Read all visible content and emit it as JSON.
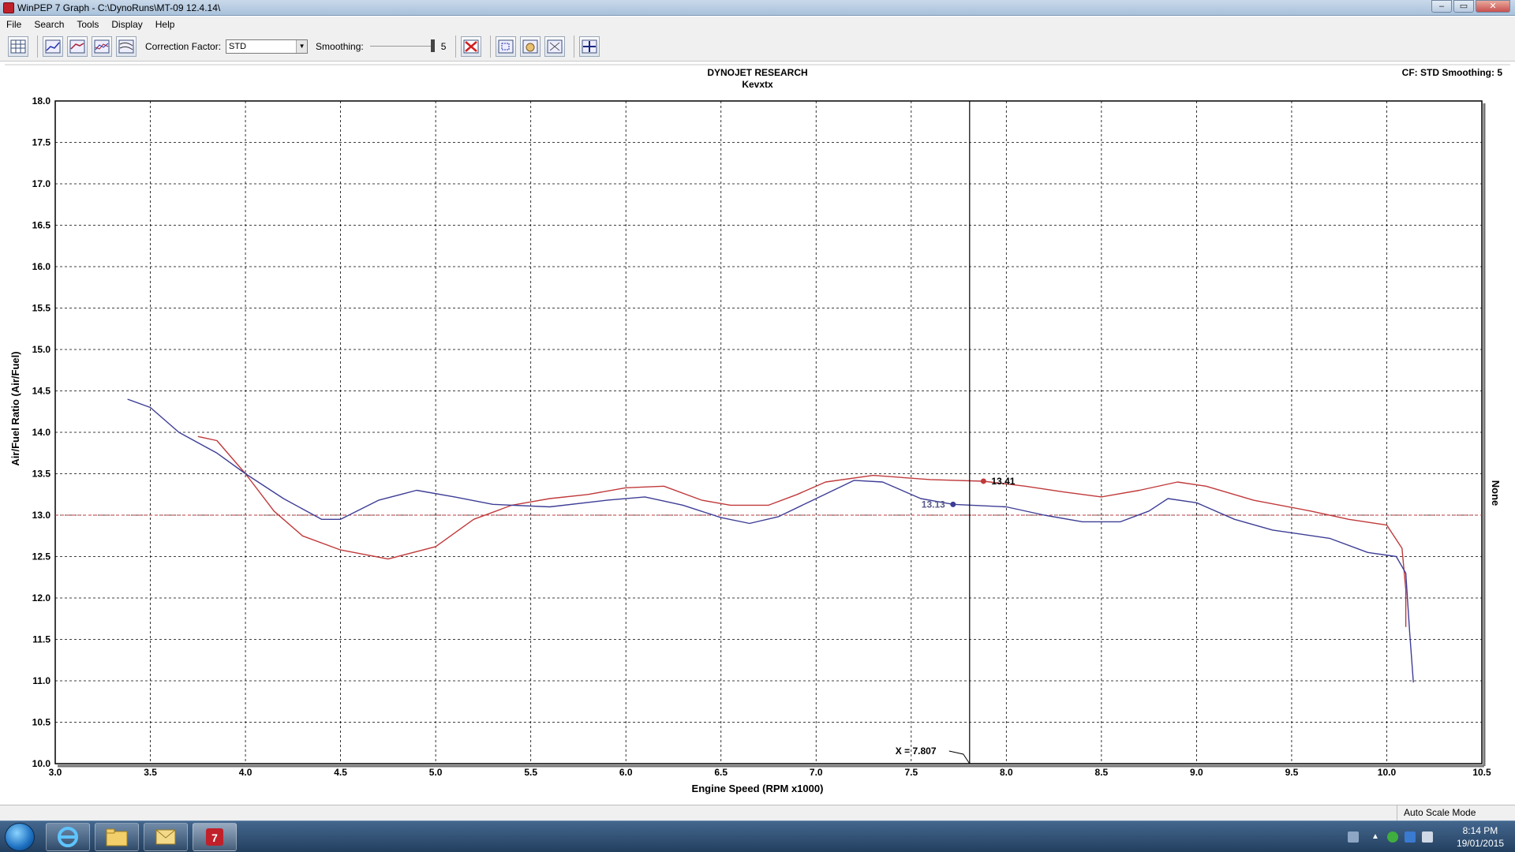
{
  "window": {
    "title": "WinPEP 7   Graph - C:\\DynoRuns\\MT-09 12.4.14\\",
    "controls": [
      "–",
      "▭",
      "✕"
    ]
  },
  "menu": [
    "File",
    "Search",
    "Tools",
    "Display",
    "Help"
  ],
  "toolbar": {
    "correction_label": "Correction Factor:",
    "correction_value": "STD",
    "smoothing_label": "Smoothing:",
    "smoothing_value": "5",
    "icons": [
      "grid-icon",
      "graph-hp-icon",
      "graph-torque-icon",
      "graph-multi-icon",
      "graph-overlay-icon",
      "remove-run-icon",
      "zoom-icon",
      "pan-hand-icon",
      "autoscale-icon",
      "crosshair-icon"
    ]
  },
  "colors": {
    "red_series": "#c0393b",
    "blue_series": "#3d3d96",
    "grid": "#000000",
    "cursor_line": "#000000"
  },
  "chart_data": {
    "type": "line",
    "title": "DYNOJET RESEARCH",
    "subtitle": "Kevxtx",
    "top_right": "CF: STD  Smoothing: 5",
    "right_axis_label": "None",
    "xlabel": "Engine Speed (RPM x1000)",
    "ylabel": "Air/Fuel Ratio (Air/Fuel)",
    "xlim": [
      3.0,
      10.5
    ],
    "ylim": [
      10.0,
      18.0
    ],
    "xticks": [
      "3.0",
      "3.5",
      "4.0",
      "4.5",
      "5.0",
      "5.5",
      "6.0",
      "6.5",
      "7.0",
      "7.5",
      "8.0",
      "8.5",
      "9.0",
      "9.5",
      "10.0",
      "10.5"
    ],
    "yticks": [
      "10.0",
      "10.5",
      "11.0",
      "11.5",
      "12.0",
      "12.5",
      "13.0",
      "13.5",
      "14.0",
      "14.5",
      "15.0",
      "15.5",
      "16.0",
      "16.5",
      "17.0",
      "17.5",
      "18.0"
    ],
    "grid": true,
    "reference_line_y": 13.0,
    "cursor": {
      "x": 7.807,
      "label": "X = 7.807"
    },
    "series": [
      {
        "color": "#c0393b",
        "marker": {
          "x": 7.88,
          "y": 13.41,
          "label": "13.41"
        },
        "points": [
          [
            3.75,
            13.95
          ],
          [
            3.85,
            13.9
          ],
          [
            4.0,
            13.5
          ],
          [
            4.15,
            13.05
          ],
          [
            4.3,
            12.75
          ],
          [
            4.5,
            12.58
          ],
          [
            4.75,
            12.47
          ],
          [
            5.0,
            12.62
          ],
          [
            5.2,
            12.95
          ],
          [
            5.4,
            13.12
          ],
          [
            5.6,
            13.2
          ],
          [
            5.8,
            13.25
          ],
          [
            6.0,
            13.33
          ],
          [
            6.2,
            13.35
          ],
          [
            6.4,
            13.18
          ],
          [
            6.55,
            13.12
          ],
          [
            6.75,
            13.12
          ],
          [
            6.9,
            13.25
          ],
          [
            7.05,
            13.4
          ],
          [
            7.3,
            13.48
          ],
          [
            7.6,
            13.43
          ],
          [
            7.88,
            13.41
          ],
          [
            8.1,
            13.35
          ],
          [
            8.3,
            13.28
          ],
          [
            8.5,
            13.22
          ],
          [
            8.7,
            13.3
          ],
          [
            8.9,
            13.4
          ],
          [
            9.05,
            13.35
          ],
          [
            9.3,
            13.18
          ],
          [
            9.6,
            13.05
          ],
          [
            9.8,
            12.95
          ],
          [
            10.0,
            12.88
          ],
          [
            10.08,
            12.6
          ],
          [
            10.1,
            12.1
          ],
          [
            10.1,
            11.65
          ]
        ]
      },
      {
        "color": "#3d3d96",
        "marker": {
          "x": 7.72,
          "y": 13.13,
          "label": "13.13"
        },
        "points": [
          [
            3.38,
            14.4
          ],
          [
            3.5,
            14.3
          ],
          [
            3.65,
            14.0
          ],
          [
            3.85,
            13.75
          ],
          [
            4.0,
            13.5
          ],
          [
            4.2,
            13.2
          ],
          [
            4.4,
            12.95
          ],
          [
            4.5,
            12.95
          ],
          [
            4.7,
            13.18
          ],
          [
            4.9,
            13.3
          ],
          [
            5.1,
            13.22
          ],
          [
            5.3,
            13.13
          ],
          [
            5.6,
            13.1
          ],
          [
            5.9,
            13.18
          ],
          [
            6.1,
            13.22
          ],
          [
            6.3,
            13.12
          ],
          [
            6.5,
            12.97
          ],
          [
            6.65,
            12.9
          ],
          [
            6.8,
            12.98
          ],
          [
            7.0,
            13.2
          ],
          [
            7.2,
            13.42
          ],
          [
            7.35,
            13.4
          ],
          [
            7.55,
            13.2
          ],
          [
            7.72,
            13.13
          ],
          [
            8.0,
            13.1
          ],
          [
            8.2,
            13.0
          ],
          [
            8.4,
            12.92
          ],
          [
            8.6,
            12.92
          ],
          [
            8.75,
            13.05
          ],
          [
            8.85,
            13.2
          ],
          [
            9.0,
            13.15
          ],
          [
            9.2,
            12.95
          ],
          [
            9.4,
            12.82
          ],
          [
            9.7,
            12.72
          ],
          [
            9.9,
            12.55
          ],
          [
            10.05,
            12.5
          ],
          [
            10.1,
            12.3
          ],
          [
            10.12,
            11.6
          ],
          [
            10.14,
            10.98
          ]
        ]
      }
    ]
  },
  "status": {
    "mode": "Auto Scale Mode"
  },
  "taskbar": {
    "time": "8:14 PM",
    "date": "19/01/2015"
  }
}
